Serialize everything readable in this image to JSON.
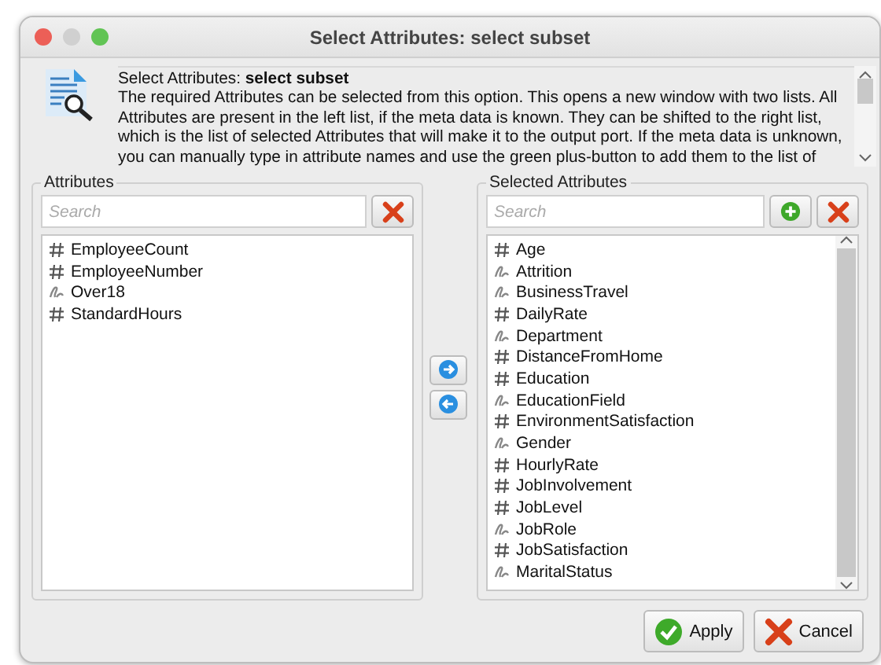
{
  "window": {
    "title": "Select Attributes: select subset"
  },
  "description": {
    "heading": "Select Attributes: **select subset**",
    "text": "The required Attributes can be selected from this option. This opens a new window with two lists. All Attributes are present in the left list, if the meta data is known. They can be shifted to the right list, which is the list of selected Attributes that will make it to the output port. If the meta data is unknown, you can manually type in attribute names and use the green plus-button to add them to the list of"
  },
  "attributes": {
    "title": "Attributes",
    "search": {
      "placeholder": "Search"
    },
    "items": [
      {
        "name": "EmployeeCount",
        "kind": "numeric"
      },
      {
        "name": "EmployeeNumber",
        "kind": "numeric"
      },
      {
        "name": "Over18",
        "kind": "nominal"
      },
      {
        "name": "StandardHours",
        "kind": "numeric"
      }
    ]
  },
  "selected_attributes": {
    "title": "Selected Attributes",
    "search": {
      "placeholder": "Search"
    },
    "items": [
      {
        "name": "Age",
        "kind": "numeric"
      },
      {
        "name": "Attrition",
        "kind": "nominal"
      },
      {
        "name": "BusinessTravel",
        "kind": "nominal"
      },
      {
        "name": "DailyRate",
        "kind": "numeric"
      },
      {
        "name": "Department",
        "kind": "nominal"
      },
      {
        "name": "DistanceFromHome",
        "kind": "numeric"
      },
      {
        "name": "Education",
        "kind": "numeric"
      },
      {
        "name": "EducationField",
        "kind": "nominal"
      },
      {
        "name": "EnvironmentSatisfaction",
        "kind": "numeric"
      },
      {
        "name": "Gender",
        "kind": "nominal"
      },
      {
        "name": "HourlyRate",
        "kind": "numeric"
      },
      {
        "name": "JobInvolvement",
        "kind": "numeric"
      },
      {
        "name": "JobLevel",
        "kind": "numeric"
      },
      {
        "name": "JobRole",
        "kind": "nominal"
      },
      {
        "name": "JobSatisfaction",
        "kind": "numeric"
      },
      {
        "name": "MaritalStatus",
        "kind": "nominal"
      }
    ]
  },
  "buttons": [
    {
      "label": "Apply",
      "kind": "apply"
    },
    {
      "label": "Cancel",
      "kind": "cancel"
    }
  ]
}
